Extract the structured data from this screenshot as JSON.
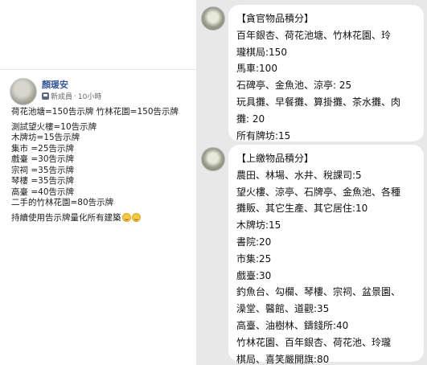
{
  "post": {
    "author": "顏瑗安",
    "role": "新成員",
    "separator": "·",
    "time": "10小時",
    "lines": [
      "荷花池塘=150告示牌 竹林花園=150告示牌",
      "測試望火樓=10告示牌",
      "木牌坊=15告示牌",
      "集市 =25告示牌",
      "戲臺 =30告示牌",
      "宗祠 =35告示牌",
      "琴樓 =35告示牌",
      "高臺 =40告示牌",
      "二手的竹林花園=80告示牌",
      "持續使用告示牌量化所有建築"
    ]
  },
  "chat": {
    "messages": [
      {
        "lines": [
          "【貪官物品積分】",
          "百年銀杏、荷花池塘、竹林花園、玲",
          "瓏棋局:150",
          "馬車:100",
          "石碑亭、金魚池、涼亭: 25",
          "玩具攤、早餐攤、算掛攤、茶水攤、肉",
          "攤: 20",
          "所有牌坊:15"
        ]
      },
      {
        "lines": [
          "【上繳物品積分】",
          "農田、林場、水井、稅課司:5",
          "望火樓、涼亭、石牌亭、金魚池、各種",
          "攤販、其它生產、其它居住:10",
          "木牌坊:15",
          "書院:20",
          "市集:25",
          "戲臺:30",
          "釣魚台、勾欄、琴樓、宗祠、盆景園、",
          "澡堂、醫館、道觀:35",
          "高臺、油樹林、鑄錢所:40",
          "竹林花園、百年銀杏、荷花池、玲瓏",
          "棋局、喜笑嚴開旗:80"
        ]
      }
    ]
  }
}
